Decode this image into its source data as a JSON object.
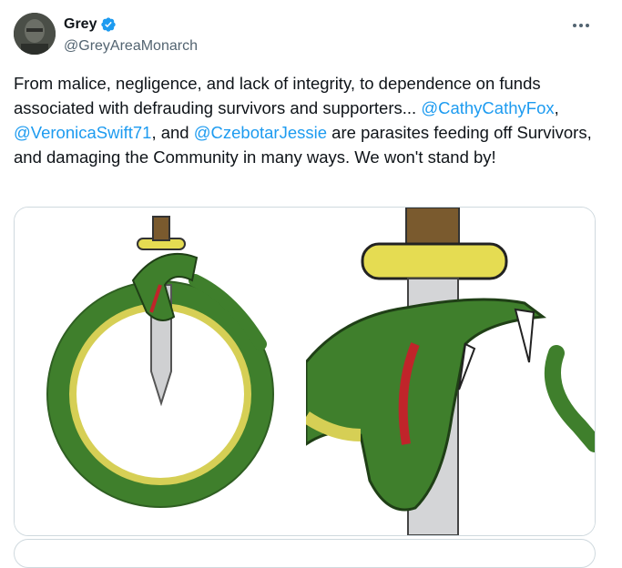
{
  "author": {
    "display_name": "Grey",
    "handle": "@GreyAreaMonarch",
    "verified_icon": "verified-badge-icon",
    "avatar_icon": "avatar-photo"
  },
  "more_icon": "more-options-icon",
  "tweet": {
    "part1": "From malice, negligence, and lack of integrity, to dependence on funds associated with defrauding survivors and supporters... ",
    "mention1": "@CathyCathyFox",
    "sep1": ", ",
    "mention2": "@VeronicaSwift71",
    "sep2": ", and ",
    "mention3": "@CzebotarJessie",
    "part2": " are parasites feeding off Survivors, and damaging the Community in many ways. We won't stand by!"
  },
  "colors": {
    "mention": "#1d9bf0",
    "verified": "#1d9bf0",
    "snake_green": "#3f7f2c",
    "snake_belly": "#d6cf55",
    "blade": "#cfd0d2",
    "guard": "#e5dc52",
    "handle": "#7a5a2e",
    "blood": "#c0242a"
  },
  "media": [
    {
      "name": "ouroboros-dagger-image",
      "description_icon": "snake-dagger-illustration"
    },
    {
      "name": "snake-dagger-closeup-image",
      "description_icon": "snake-dagger-closeup"
    }
  ]
}
